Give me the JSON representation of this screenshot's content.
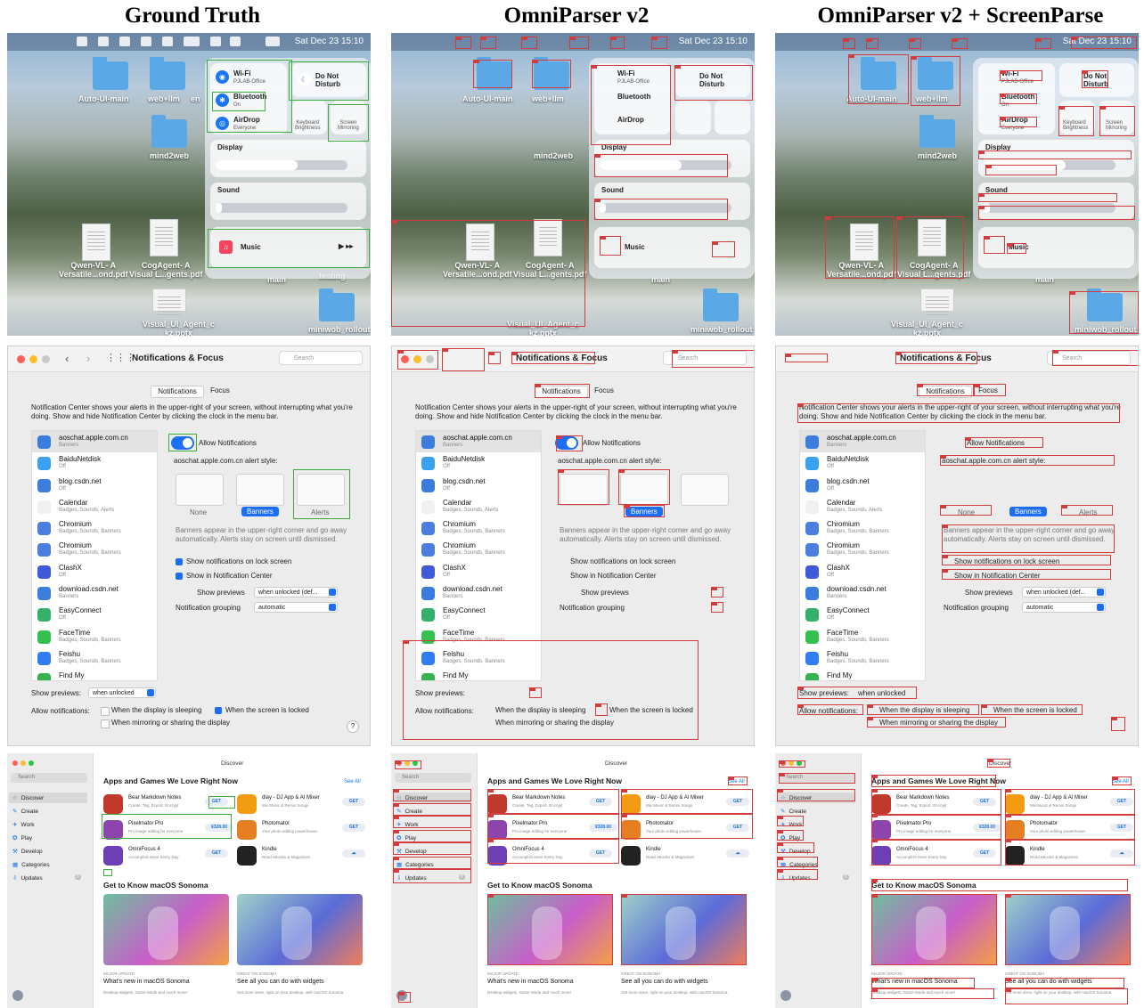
{
  "headers": [
    "Ground Truth",
    "OmniParser v2",
    "OmniParser v2 + ScreenParse"
  ],
  "desktop": {
    "clock": "Sat Dec 23  15:10",
    "files": [
      {
        "label": "Auto-UI-main"
      },
      {
        "label": "web+llm"
      },
      {
        "label": "en"
      },
      {
        "label": "mind2web"
      },
      {
        "label": "Qwen-VL- A\nVersatile...ond.pdf"
      },
      {
        "label": "CogAgent- A\nVisual L...gents.pdf"
      },
      {
        "label": "main"
      },
      {
        "label": "testing"
      },
      {
        "label": "Visual_UI_Agent_c\nkz.pptx"
      },
      {
        "label": "miniwob_rollout"
      }
    ],
    "control_center": {
      "wifi": {
        "title": "Wi-Fi",
        "subtitle": "PJLAB-Office"
      },
      "bluetooth": {
        "title": "Bluetooth",
        "subtitle": "On"
      },
      "airdrop": {
        "title": "AirDrop",
        "subtitle": "Everyone"
      },
      "dnd": {
        "title": "Do Not\nDisturb"
      },
      "keyboard": {
        "title": "Keyboard\nBrightness"
      },
      "mirroring": {
        "title": "Screen\nMirroring"
      },
      "display": {
        "title": "Display",
        "level": 0.62
      },
      "sound": {
        "title": "Sound",
        "level": 0.05
      },
      "music": {
        "title": "Music"
      }
    }
  },
  "notifications": {
    "window_title": "Notifications & Focus",
    "search_placeholder": "Search",
    "tabs": [
      "Notifications",
      "Focus"
    ],
    "description": "Notification Center shows your alerts in the upper-right of your screen, without interrupting what you're doing. Show and hide Notification Center by clicking the clock in the menu bar.",
    "apps": [
      {
        "name": "aoschat.apple.com.cn",
        "sub": "Banners",
        "color": "#3b7ddd"
      },
      {
        "name": "BaiduNetdisk",
        "sub": "Off",
        "color": "#3aa0f0"
      },
      {
        "name": "blog.csdn.net",
        "sub": "Off",
        "color": "#3b7ddd"
      },
      {
        "name": "Calendar",
        "sub": "Badges, Sounds, Alerts",
        "color": "#f0f0f0"
      },
      {
        "name": "Chromium",
        "sub": "Badges, Sounds, Banners",
        "color": "#4a7fe0"
      },
      {
        "name": "Chromium",
        "sub": "Badges, Sounds, Banners",
        "color": "#4a7fe0"
      },
      {
        "name": "ClashX",
        "sub": "Off",
        "color": "#4059d8"
      },
      {
        "name": "download.csdn.net",
        "sub": "Banners",
        "color": "#3b7ddd"
      },
      {
        "name": "EasyConnect",
        "sub": "Off",
        "color": "#35b06a"
      },
      {
        "name": "FaceTime",
        "sub": "Badges, Sounds, Banners",
        "color": "#33c04f"
      },
      {
        "name": "Feishu",
        "sub": "Badges, Sounds, Banners",
        "color": "#2f7df0"
      },
      {
        "name": "Find My",
        "sub": "",
        "color": "#36b34d"
      }
    ],
    "allow_label": "Allow Notifications",
    "alert_style_label": "aoschat.apple.com.cn alert style:",
    "styles": [
      "None",
      "Banners",
      "Alerts"
    ],
    "banner_help": "Banners appear in the upper-right corner and go away automatically. Alerts stay on screen until dismissed.",
    "lock_screen": "Show notifications on lock screen",
    "in_center": "Show in Notification Center",
    "show_previews_label": "Show previews",
    "show_previews_value": "when unlocked (def...",
    "grouping_label": "Notification grouping",
    "grouping_value": "automatic",
    "bottom_previews_label": "Show previews:",
    "bottom_previews_value": "when unlocked",
    "allow_when_label": "Allow notifications:",
    "sleeping": "When the display is sleeping",
    "locked": "When the screen is locked",
    "mirroring": "When mirroring or sharing the display",
    "help": "?"
  },
  "appstore": {
    "window_title": "Discover",
    "search": "Search",
    "sidebar": [
      "Discover",
      "Create",
      "Work",
      "Play",
      "Develop",
      "Categories",
      "Updates"
    ],
    "sidebar_icons": [
      "☆",
      "✎",
      "✈",
      "✪",
      "⚒",
      "▦",
      "⇩"
    ],
    "updates_badge": "8",
    "section1": "Apps and Games We Love Right Now",
    "see_all": "See All",
    "apps": [
      {
        "name": "Bear Markdown Notes",
        "desc": "Create, Tag, Export, Encrypt",
        "button": "GET",
        "color": "#c0392b"
      },
      {
        "name": "dlay - DJ App & AI Mixer",
        "desc": "Mix Music & Remix Songs",
        "button": "GET",
        "color": "#f39c12"
      },
      {
        "name": "Pixelmator Pro",
        "desc": "Pro image editing for everyone",
        "button": "¥328.00",
        "color": "#8e44ad"
      },
      {
        "name": "Photomator",
        "desc": "Your photo editing powerhouse.",
        "button": "GET",
        "color": "#e67e22"
      },
      {
        "name": "OmniFocus 4",
        "desc": "Accomplish More Every Day",
        "button": "GET",
        "color": "#6c3fb5"
      },
      {
        "name": "Kindle",
        "desc": "Read eBooks & Magazines",
        "button": "☁",
        "color": "#222222"
      }
    ],
    "section2": "Get to Know macOS Sonoma",
    "cards": [
      {
        "kicker": "MAJOR UPDATE",
        "title": "What's new in macOS Sonoma",
        "desc": "Desktop widgets, Game Mode and much more!"
      },
      {
        "kicker": "GREAT ON SONOMA",
        "title": "See all you can do with widgets",
        "desc": "Get more done, right on your desktop, with macOS Sonoma."
      }
    ]
  }
}
